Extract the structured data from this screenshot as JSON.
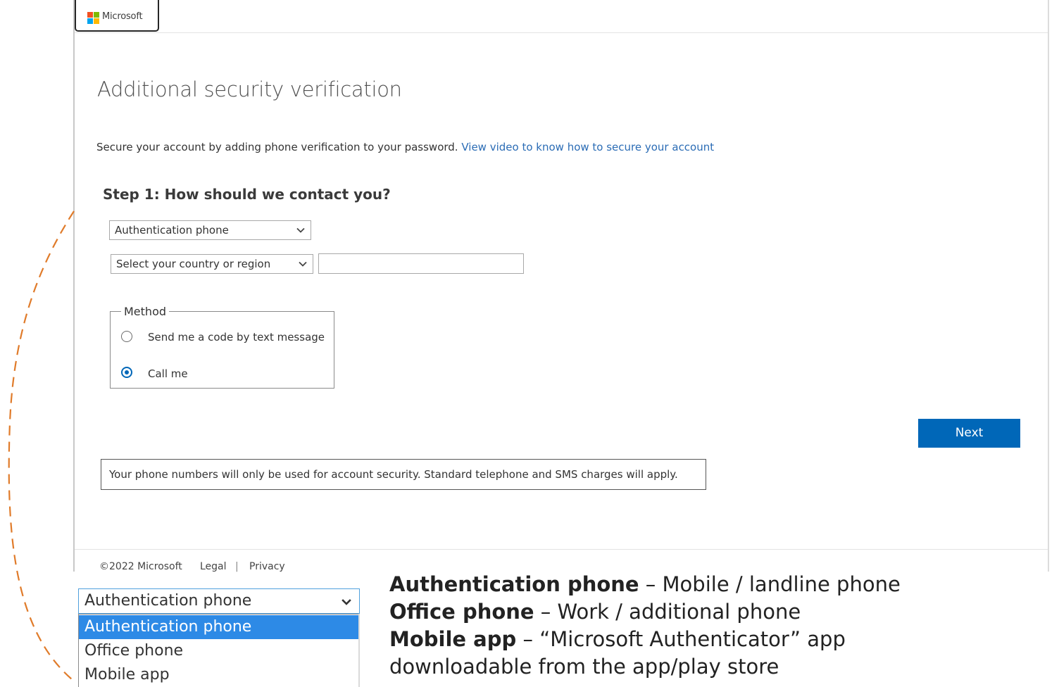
{
  "brand": {
    "logo_text": "Microsoft",
    "logo_colors": [
      "#f25022",
      "#7fba00",
      "#00a4ef",
      "#ffb900"
    ]
  },
  "page": {
    "title": "Additional security verification",
    "intro": "Secure your account by adding phone verification to your password.",
    "intro_link": "View video to know how to secure your account"
  },
  "step1": {
    "heading": "Step 1: How should we contact you?",
    "contact_method_selected": "Authentication phone",
    "country_selected": "Select your country or region",
    "phone_number_value": "",
    "method_legend": "Method",
    "method_options": [
      {
        "label": "Send me a code by text message",
        "checked": false
      },
      {
        "label": "Call me",
        "checked": true
      }
    ]
  },
  "actions": {
    "next_label": "Next"
  },
  "notice": "Your phone numbers will only be used for account security. Standard telephone and SMS charges will apply.",
  "footer": {
    "copyright": "©2022 Microsoft",
    "legal": "Legal",
    "separator": "|",
    "privacy": "Privacy"
  },
  "dropdown_expanded": {
    "selected": "Authentication phone",
    "options": [
      "Authentication phone",
      "Office phone",
      "Mobile app"
    ],
    "highlighted_index": 0
  },
  "explanations": [
    {
      "term": "Authentication phone",
      "description": " – Mobile / landline phone"
    },
    {
      "term": "Office phone",
      "description": " – Work / additional phone"
    },
    {
      "term": "Mobile app",
      "description": " – “Microsoft Authenticator” app"
    },
    {
      "term": "",
      "description": "downloadable from the app/play store"
    }
  ],
  "colors": {
    "accent": "#0067b8",
    "link": "#2b6cb5",
    "highlight": "#2d8ae6",
    "annotation_curve": "#e07b2a"
  },
  "icons": {
    "dropdown": "chevron-down-icon",
    "logo": "microsoft-logo-icon"
  }
}
